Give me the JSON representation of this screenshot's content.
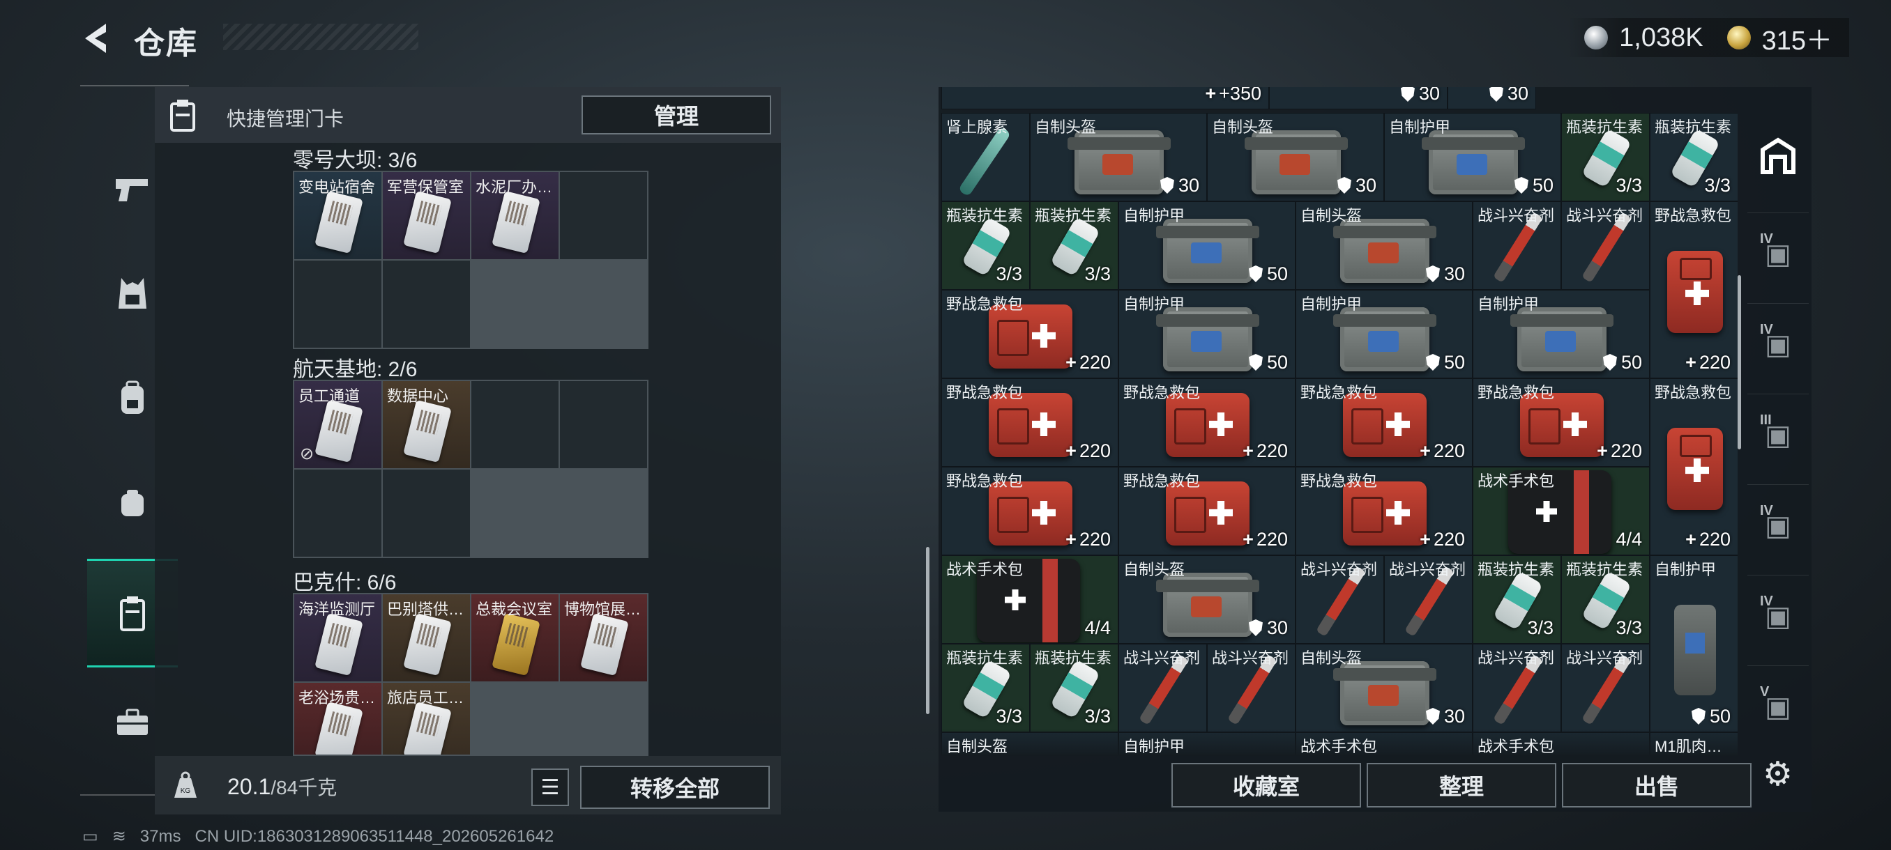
{
  "header": {
    "title": "仓库",
    "currency_silver": "1,038K",
    "currency_gold": "315＋"
  },
  "left_panel": {
    "quick_title": "快捷管理门卡",
    "manage_button": "管理",
    "sections": [
      {
        "title": "零号大坝: 3/6",
        "cards": [
          "变电站宿舍",
          "军营保管室",
          "水泥厂办…"
        ]
      },
      {
        "title": "航天基地: 2/6",
        "cards": [
          "员工通道",
          "数据中心"
        ]
      },
      {
        "title": "巴克什: 6/6",
        "cards": [
          "海洋监测厅",
          "巴别塔供…",
          "总裁会议室",
          "博物馆展…",
          "老浴场贵…",
          "旅店员工…"
        ]
      }
    ],
    "weight_value": "20.1",
    "weight_max": "/84千克",
    "transfer_all_button": "转移全部"
  },
  "status_bar": {
    "ping": "37ms",
    "uid": "CN UID:1863031289063511448_202605261642"
  },
  "inventory": {
    "top_partial": [
      "+350",
      "30",
      "30"
    ],
    "rows": [
      [
        {
          "label": "肾上腺素",
          "count": ""
        },
        {
          "label": "自制头盔",
          "count": "30"
        },
        {
          "label": "自制头盔",
          "count": "30"
        },
        {
          "label": "自制护甲",
          "count": "50"
        },
        {
          "label": "瓶装抗生素",
          "count": "3/3"
        },
        {
          "label": "瓶装抗生素",
          "count": "3/3"
        }
      ],
      [
        {
          "label": "瓶装抗生素",
          "count": "3/3"
        },
        {
          "label": "瓶装抗生素",
          "count": "3/3"
        },
        {
          "label": "自制护甲",
          "count": "50"
        },
        {
          "label": "自制头盔",
          "count": "30"
        },
        {
          "label": "战斗兴奋剂",
          "count": ""
        },
        {
          "label": "战斗兴奋剂",
          "count": ""
        },
        {
          "label": "野战急救包",
          "count": "220"
        }
      ],
      [
        {
          "label": "野战急救包",
          "count": "220"
        },
        {
          "label": "自制护甲",
          "count": "50"
        },
        {
          "label": "自制护甲",
          "count": "50"
        },
        {
          "label": "自制护甲",
          "count": "50"
        }
      ],
      [
        {
          "label": "野战急救包",
          "count": "220"
        },
        {
          "label": "野战急救包",
          "count": "220"
        },
        {
          "label": "野战急救包",
          "count": "220"
        },
        {
          "label": "野战急救包",
          "count": "220"
        },
        {
          "label": "野战急救包",
          "count": "220"
        }
      ],
      [
        {
          "label": "野战急救包",
          "count": "220"
        },
        {
          "label": "野战急救包",
          "count": "220"
        },
        {
          "label": "野战急救包",
          "count": "220"
        },
        {
          "label": "战术手术包",
          "count": "4/4"
        }
      ],
      [
        {
          "label": "战术手术包",
          "count": "4/4"
        },
        {
          "label": "自制头盔",
          "count": "30"
        },
        {
          "label": "战斗兴奋剂",
          "count": ""
        },
        {
          "label": "战斗兴奋剂",
          "count": ""
        },
        {
          "label": "瓶装抗生素",
          "count": "3/3"
        },
        {
          "label": "瓶装抗生素",
          "count": "3/3"
        },
        {
          "label": "自制护甲",
          "count": "50"
        }
      ],
      [
        {
          "label": "瓶装抗生素",
          "count": "3/3"
        },
        {
          "label": "瓶装抗生素",
          "count": "3/3"
        },
        {
          "label": "战斗兴奋剂",
          "count": ""
        },
        {
          "label": "战斗兴奋剂",
          "count": ""
        },
        {
          "label": "自制头盔",
          "count": "30"
        },
        {
          "label": "战斗兴奋剂",
          "count": ""
        },
        {
          "label": "战斗兴奋剂",
          "count": ""
        }
      ],
      [
        {
          "label": "自制头盔",
          "count": ""
        },
        {
          "label": "自制护甲",
          "count": ""
        },
        {
          "label": "战术手术包",
          "count": ""
        },
        {
          "label": "战术手术包",
          "count": ""
        },
        {
          "label": "M1肌肉…",
          "count": ""
        }
      ]
    ]
  },
  "right_tabs": [
    "IV",
    "IV",
    "III",
    "IV",
    "IV",
    "V"
  ],
  "bottom_buttons": {
    "collection": "收藏室",
    "organize": "整理",
    "sell": "出售"
  }
}
